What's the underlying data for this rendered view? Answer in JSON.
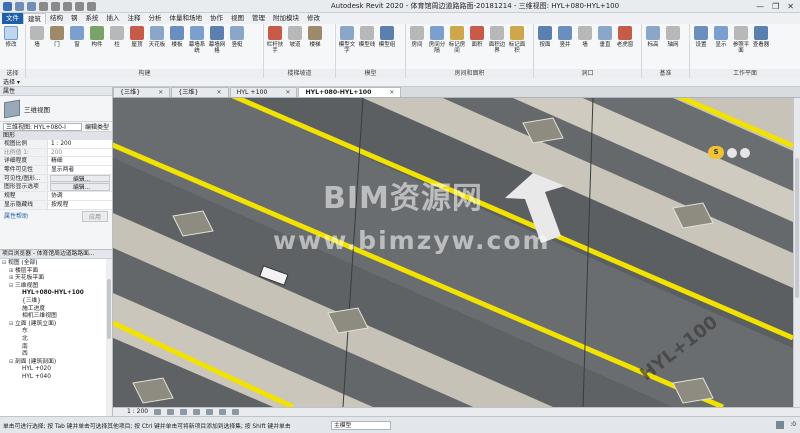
{
  "window": {
    "title": "Autodesk Revit 2020 - 体育馆周边道路路面-20181214 - 三维视图: HYL+080-HYL+100",
    "controls": [
      "—",
      "❐",
      "✕"
    ]
  },
  "menu": {
    "tabs": [
      "文件",
      "建筑",
      "结构",
      "钢",
      "系统",
      "插入",
      "注释",
      "分析",
      "体量和场地",
      "协作",
      "视图",
      "管理",
      "附加模块",
      "修改"
    ],
    "active": "建筑"
  },
  "ribbon": {
    "groups": [
      {
        "label": "选择",
        "buttons": [
          {
            "label": "修改",
            "selected": true
          }
        ]
      },
      {
        "label": "构建",
        "buttons": [
          {
            "label": "墙"
          },
          {
            "label": "门"
          },
          {
            "label": "窗"
          },
          {
            "label": "构件"
          },
          {
            "label": "柱"
          },
          {
            "label": "屋顶"
          },
          {
            "label": "天花板"
          },
          {
            "label": "楼板"
          },
          {
            "label": "幕墙系统"
          },
          {
            "label": "幕墙网格"
          },
          {
            "label": "竖梃"
          }
        ]
      },
      {
        "label": "楼梯坡道",
        "buttons": [
          {
            "label": "栏杆扶手"
          },
          {
            "label": "坡道"
          },
          {
            "label": "楼梯"
          }
        ]
      },
      {
        "label": "模型",
        "buttons": [
          {
            "label": "模型文字"
          },
          {
            "label": "模型线"
          },
          {
            "label": "模型组"
          }
        ]
      },
      {
        "label": "房间和面积",
        "buttons": [
          {
            "label": "房间"
          },
          {
            "label": "房间分隔"
          },
          {
            "label": "标记房间"
          },
          {
            "label": "面积"
          },
          {
            "label": "面积边界"
          },
          {
            "label": "标记面积"
          }
        ]
      },
      {
        "label": "洞口",
        "buttons": [
          {
            "label": "按面"
          },
          {
            "label": "竖井"
          },
          {
            "label": "墙"
          },
          {
            "label": "垂直"
          },
          {
            "label": "老虎窗"
          }
        ]
      },
      {
        "label": "基准",
        "buttons": [
          {
            "label": "标高"
          },
          {
            "label": "轴网"
          }
        ]
      },
      {
        "label": "工作平面",
        "buttons": [
          {
            "label": "设置"
          },
          {
            "label": "显示"
          },
          {
            "label": "参照平面"
          },
          {
            "label": "查看器"
          }
        ]
      }
    ]
  },
  "options_bar": {
    "label": "选择 ▾"
  },
  "properties": {
    "header": "属性",
    "type_name": "三维视图",
    "selector": "三维视图: HYL+080-I",
    "edit_type": "编辑类型",
    "category": "图形",
    "rows": [
      {
        "key": "视图比例",
        "value": "1 : 200",
        "kind": "field"
      },
      {
        "key": "比例值 1:",
        "value": "200",
        "kind": "text"
      },
      {
        "key": "详细程度",
        "value": "精细",
        "kind": "text"
      },
      {
        "key": "零件可见性",
        "value": "显示两者",
        "kind": "text"
      },
      {
        "key": "可见性/图形...",
        "value": "编辑...",
        "kind": "button"
      },
      {
        "key": "图形显示选项",
        "value": "编辑...",
        "kind": "button"
      },
      {
        "key": "规程",
        "value": "协调",
        "kind": "text"
      },
      {
        "key": "显示隐藏线",
        "value": "按规程",
        "kind": "text"
      }
    ],
    "help_link": "属性帮助",
    "apply": "应用"
  },
  "browser": {
    "header": "项目浏览器 - 体育馆周边道路路面...",
    "items": [
      {
        "label": "视图 (全部)",
        "level": 0,
        "toggle": "⊟"
      },
      {
        "label": "楼层平面",
        "level": 1,
        "toggle": "⊞"
      },
      {
        "label": "天花板平面",
        "level": 1,
        "toggle": "⊞"
      },
      {
        "label": "三维视图",
        "level": 1,
        "toggle": "⊟"
      },
      {
        "label": "HYL+080-HYL+100",
        "level": 2,
        "toggle": "",
        "bold": true
      },
      {
        "label": "{三维}",
        "level": 2,
        "toggle": ""
      },
      {
        "label": "施工进度",
        "level": 2,
        "toggle": ""
      },
      {
        "label": "相机三维视图",
        "level": 2,
        "toggle": ""
      },
      {
        "label": "立面 (建筑立面)",
        "level": 1,
        "toggle": "⊟"
      },
      {
        "label": "东",
        "level": 2,
        "toggle": ""
      },
      {
        "label": "北",
        "level": 2,
        "toggle": ""
      },
      {
        "label": "南",
        "level": 2,
        "toggle": ""
      },
      {
        "label": "西",
        "level": 2,
        "toggle": ""
      },
      {
        "label": "剖面 (建筑剖面)",
        "level": 1,
        "toggle": "⊟"
      },
      {
        "label": "HYL +020",
        "level": 2,
        "toggle": ""
      },
      {
        "label": "HYL +040",
        "level": 2,
        "toggle": ""
      }
    ]
  },
  "view_tabs": [
    {
      "label": "{三维}",
      "active": false
    },
    {
      "label": "{三维}",
      "active": false
    },
    {
      "label": "HYL +100",
      "active": false
    },
    {
      "label": "HYL+080-HYL+100",
      "active": true
    }
  ],
  "viewport": {
    "watermark_title": "BIM资源网",
    "watermark_url": "www.bimzyw.com",
    "road_label": "HYL+100",
    "nav_label": "S",
    "colors": {
      "asphalt": "#616466",
      "lane_yellow": "#f2e200",
      "sidewalk": "#c4c0b4",
      "curb": "#d8d6d0"
    }
  },
  "view_control": {
    "scale": "1 : 200"
  },
  "status": {
    "message": "单击可进行选择; 按 Tab 键并单击可选择其他项目; 按 Ctrl 键并单击可将新项目添加到选择集; 按 Shift 键并单击",
    "workset": "主模型",
    "filter_count": ":0"
  }
}
